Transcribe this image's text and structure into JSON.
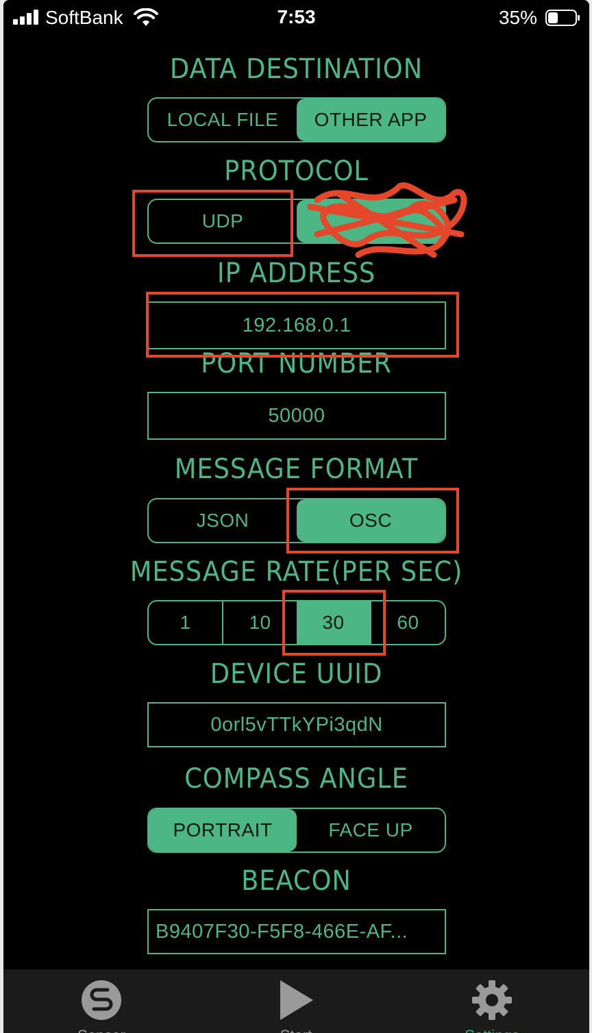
{
  "status_bar": {
    "carrier": "SoftBank",
    "time": "7:53",
    "battery": "35%"
  },
  "data_destination": {
    "heading": "DATA DESTINATION",
    "options": [
      "LOCAL FILE",
      "OTHER APP"
    ],
    "selected": "OTHER APP"
  },
  "protocol": {
    "heading": "PROTOCOL",
    "options": [
      "UDP"
    ]
  },
  "ip_address": {
    "heading": "IP ADDRESS",
    "value": "192.168.0.1"
  },
  "port_number": {
    "heading": "PORT NUMBER",
    "value": "50000"
  },
  "message_format": {
    "heading": "MESSAGE FORMAT",
    "options": [
      "JSON",
      "OSC"
    ],
    "selected": "OSC"
  },
  "message_rate": {
    "heading": "MESSAGE RATE(PER SEC)",
    "options": [
      "1",
      "10",
      "30",
      "60"
    ],
    "selected": "30"
  },
  "device_uuid": {
    "heading": "DEVICE UUID",
    "value": "0orl5vTTkYPi3qdN"
  },
  "compass_angle": {
    "heading": "COMPASS ANGLE",
    "options": [
      "PORTRAIT",
      "FACE UP"
    ],
    "selected": "PORTRAIT"
  },
  "beacon": {
    "heading": "BEACON",
    "value": "B9407F30-F5F8-466E-AF..."
  },
  "tab_bar": {
    "tabs": [
      "Sensor",
      "Start",
      "Settings"
    ],
    "active": "Settings"
  },
  "colors": {
    "accent": "#4cb784",
    "annotation": "#e5472b",
    "background": "#000000"
  }
}
